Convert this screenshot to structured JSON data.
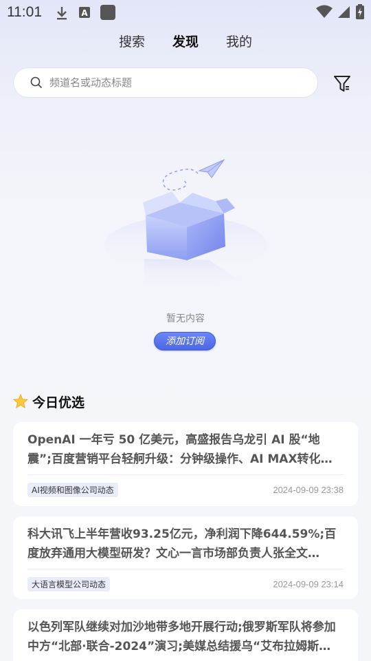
{
  "status": {
    "time": "11:01",
    "icons": [
      "download-icon",
      "keyboard-a-icon",
      "app-square-icon",
      "wifi-icon",
      "signal-icon",
      "battery-icon"
    ]
  },
  "tabs": [
    {
      "label": "搜索",
      "active": false
    },
    {
      "label": "发现",
      "active": true
    },
    {
      "label": "我的",
      "active": false
    }
  ],
  "search": {
    "placeholder": "频道名或动态标题",
    "value": ""
  },
  "empty": {
    "text": "暂无内容",
    "button": "添加订阅"
  },
  "section": {
    "title": "今日优选"
  },
  "cards": [
    {
      "title": "OpenAI 一年亏 50 亿美元，高盛报告乌龙引 AI 股“地震”;百度营销平台轻舸升级：分钟级操作、AI MAX转化率提…",
      "tag": "AI视频和图像公司动态",
      "date": "2024-09-09 23:38"
    },
    {
      "title": "科大讯飞上半年营收93.25亿元，净利润下降644.59%;百度放弃通用大模型研发？文心一言市场部负责人张全文…",
      "tag": "大语言模型公司动态",
      "date": "2024-09-09 23:14"
    },
    {
      "title": "以色列军队继续对加沙地带多地开展行动;俄罗斯军队将参加中方“北部·联合-2024”演习;美媒总结援乌“艾布拉姆斯…",
      "tag": "",
      "date": ""
    }
  ],
  "colors": {
    "accent": "#4d66e6",
    "tag_bg": "#e9ecfb",
    "background": "#f5f6fa"
  }
}
